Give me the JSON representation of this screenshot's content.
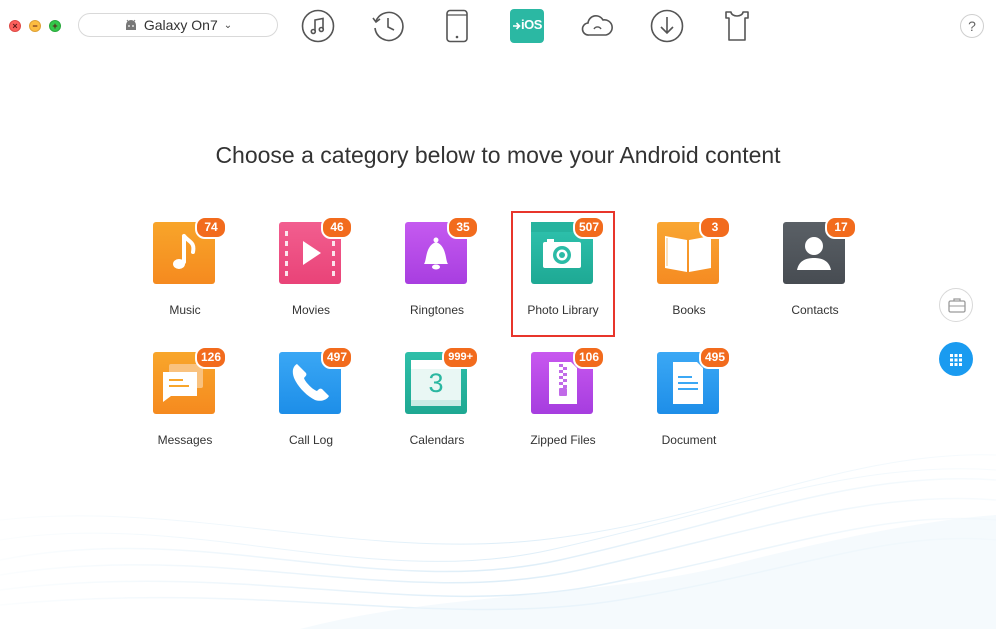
{
  "toolbar": {
    "device_name": "Galaxy On7",
    "help_label": "?"
  },
  "heading": "Choose a category below to move your Android content",
  "categories": [
    {
      "label": "Music",
      "count": "74"
    },
    {
      "label": "Movies",
      "count": "46"
    },
    {
      "label": "Ringtones",
      "count": "35"
    },
    {
      "label": "Photo Library",
      "count": "507"
    },
    {
      "label": "Books",
      "count": "3"
    },
    {
      "label": "Contacts",
      "count": "17"
    },
    {
      "label": "Messages",
      "count": "126"
    },
    {
      "label": "Call Log",
      "count": "497"
    },
    {
      "label": "Calendars",
      "count": "999+"
    },
    {
      "label": "Zipped Files",
      "count": "106"
    },
    {
      "label": "Document",
      "count": "495"
    }
  ],
  "calendar_day": "3",
  "ios_label": "iOS",
  "colors": {
    "badge": "#f26b1d",
    "selection": "#e8352b",
    "accent": "#1a9bf0"
  }
}
